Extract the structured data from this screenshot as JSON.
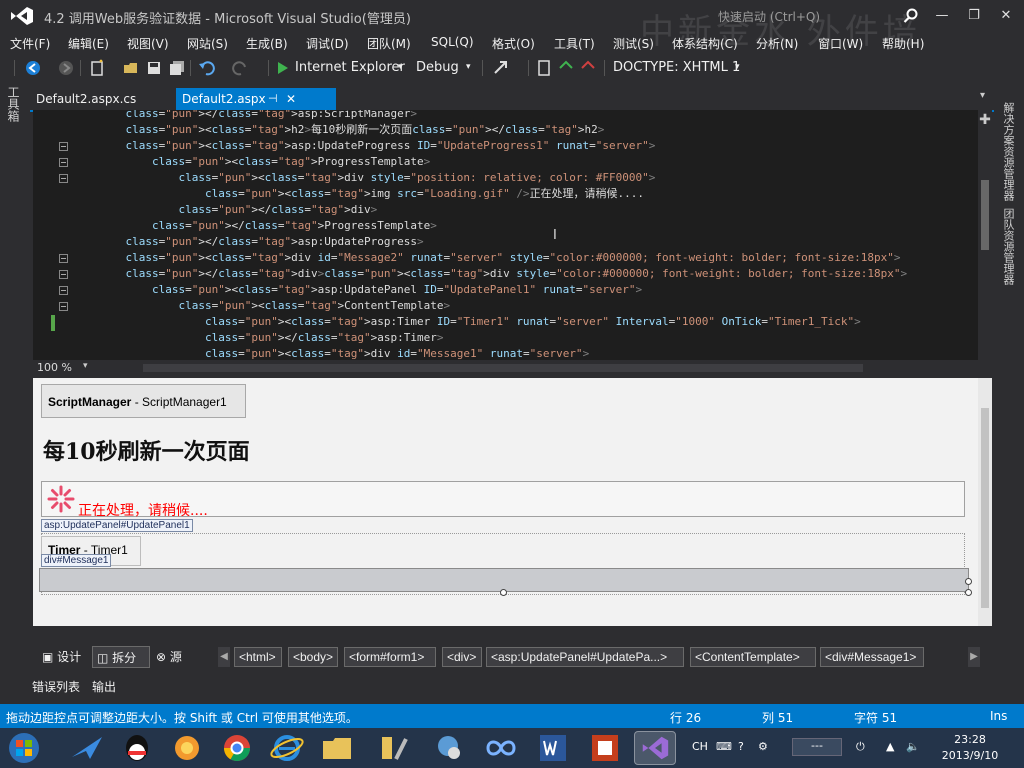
{
  "window": {
    "title": "4.2  调用Web服务验证数据 - Microsoft Visual Studio(管理员)",
    "watermark": "中新金水 外件培",
    "quick_launch": "快速启动 (Ctrl+Q)",
    "minimize": "—",
    "restore": "❐",
    "close": "✕"
  },
  "menu": [
    "文件(F)",
    "编辑(E)",
    "视图(V)",
    "网站(S)",
    "生成(B)",
    "调试(D)",
    "团队(M)",
    "SQL(Q)",
    "格式(O)",
    "工具(T)",
    "测试(S)",
    "体系结构(C)",
    "分析(N)",
    "窗口(W)",
    "帮助(H)"
  ],
  "toolbar": {
    "browser": "Internet Explorer",
    "config": "Debug",
    "doctype": "DOCTYPE:  XHTML 1"
  },
  "side_panels": {
    "left": "工具箱",
    "right": [
      "解决方案资源管理器",
      "团队资源管理器"
    ]
  },
  "tabs": [
    {
      "label": "Default2.aspx.cs",
      "active": false
    },
    {
      "label": "Default2.aspx",
      "active": true
    }
  ],
  "editor": {
    "zoom": "100 %",
    "lines": [
      "    </asp:ScriptManager>",
      "    <h2>每10秒刷新一次页面</h2>",
      "    <asp:UpdateProgress ID=\"UpdateProgress1\" runat=\"server\">",
      "        <ProgressTemplate>",
      "            <div style=\"position: relative; color: #FF0000\">",
      "                <img src=\"Loading.gif\" />正在处理，请稍候....",
      "            </div>",
      "        </ProgressTemplate>",
      "    </asp:UpdateProgress>",
      "    <div id=\"Message2\" runat=\"server\" style=\"color:#000000; font-weight: bolder; font-size:18px\">",
      "    </div><div style=\"color:#000000; font-weight: bolder; font-size:18px\">",
      "        <asp:UpdatePanel ID=\"UpdatePanel1\" runat=\"server\">",
      "            <ContentTemplate>",
      "                <asp:Timer ID=\"Timer1\" runat=\"server\" Interval=\"1000\" OnTick=\"Timer1_Tick\">",
      "                </asp:Timer>",
      "                <div id=\"Message1\" runat=\"server\">"
    ]
  },
  "design": {
    "script_manager_type": "ScriptManager",
    "script_manager_id": " - ScriptManager1",
    "heading": "每10秒刷新一次页面",
    "progress_text": "正在处理，请稍候....",
    "update_panel_label": "asp:UpdatePanel#UpdatePanel1",
    "timer_type": "Timer",
    "timer_id": " - Timer1",
    "message_label": "div#Message1"
  },
  "view_bar": {
    "design": "设计",
    "split": "拆分",
    "source": "源",
    "breadcrumbs": [
      "<html>",
      "<body>",
      "<form#form1>",
      "<div>",
      "<asp:UpdatePanel#UpdatePa...>",
      "<ContentTemplate>",
      "<div#Message1>"
    ]
  },
  "output_tabs": [
    "错误列表",
    "输出"
  ],
  "status": {
    "message": "拖动边距控点可调整边距大小。按 Shift 或 Ctrl 可使用其他选项。",
    "line": "行 26",
    "col": "列 51",
    "char": "字符 51",
    "mode": "Ins"
  },
  "taskbar": {
    "lang": "CH",
    "time": "23:28",
    "date": "2013/9/10",
    "input_box": "---"
  },
  "colors": {
    "accent": "#007acc",
    "progress_red": "#ff0000"
  }
}
